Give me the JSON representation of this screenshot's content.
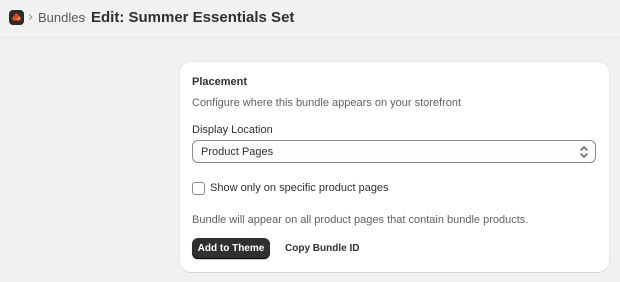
{
  "header": {
    "app_icon": "bundle-app-logo",
    "breadcrumb_separator": "›",
    "breadcrumb_parent": "Bundles",
    "page_title": "Edit: Summer Essentials Set"
  },
  "placement_card": {
    "title": "Placement",
    "description": "Configure where this bundle appears on your storefront",
    "display_location": {
      "label": "Display Location",
      "value": "Product Pages"
    },
    "checkbox": {
      "label": "Show only on specific product pages",
      "checked": false
    },
    "info_text": "Bundle will appear on all product pages that contain bundle products.",
    "primary_button": "Add to Theme",
    "secondary_button": "Copy Bundle ID"
  },
  "colors": {
    "page_bg": "#f1f1f1",
    "card_bg": "#ffffff",
    "primary_button_bg": "#303030",
    "logo_accent": "#e8502a"
  }
}
